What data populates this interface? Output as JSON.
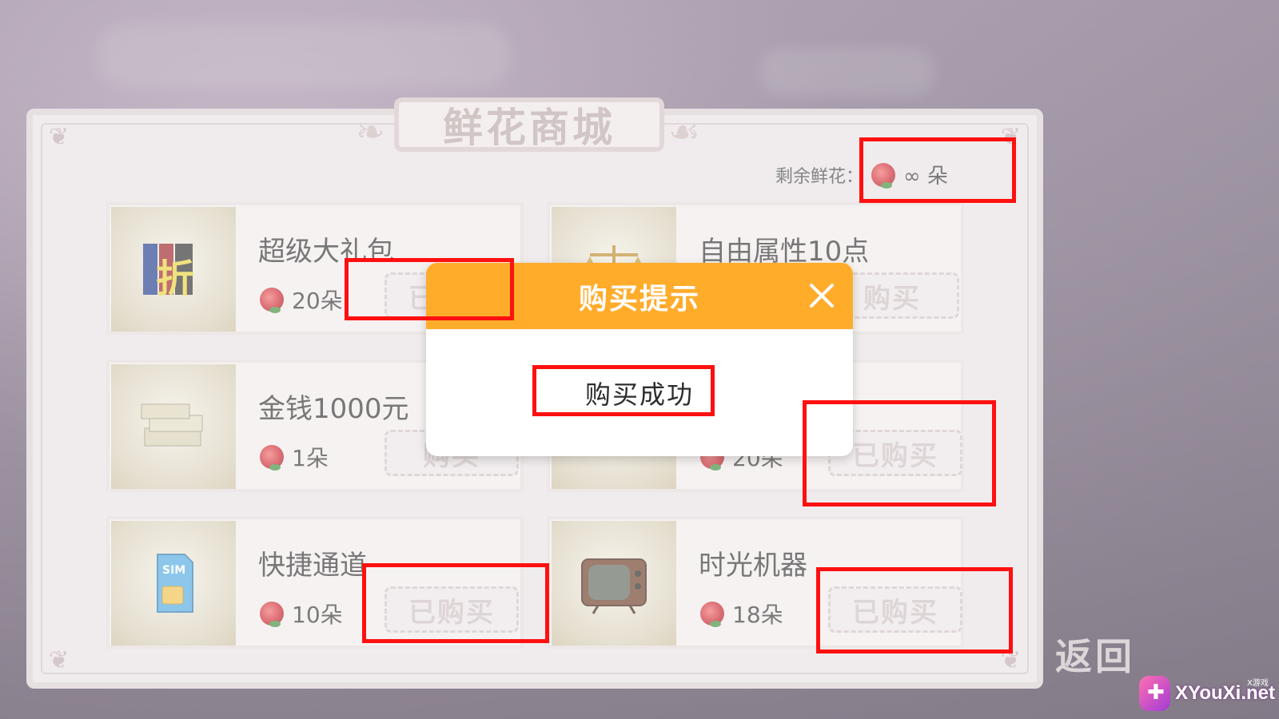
{
  "shop": {
    "title": "鲜花商城",
    "remaining_label": "剩余鲜花：",
    "remaining_amount": "∞ 朵",
    "back_label": "返回",
    "items": [
      {
        "name": "超级大礼包",
        "price": "20朵",
        "button": "已购买",
        "icon": "binders-discount-icon"
      },
      {
        "name": "自由属性10点",
        "price": "",
        "button": "购买",
        "icon": "scale-icon"
      },
      {
        "name": "金钱1000元",
        "price": "1朵",
        "button": "购买",
        "icon": "money-stack-icon"
      },
      {
        "name": "",
        "price": "20朵",
        "button": "已购买",
        "icon": "item-icon"
      },
      {
        "name": "快捷通道",
        "price": "10朵",
        "button": "已购买",
        "icon": "sim-card-icon"
      },
      {
        "name": "时光机器",
        "price": "18朵",
        "button": "已购买",
        "icon": "tv-icon"
      }
    ]
  },
  "dialog": {
    "title": "购买提示",
    "message": "购买成功",
    "close_icon": "close-icon"
  },
  "watermark": {
    "text": "XYouXi.net",
    "sub": "X游戏"
  },
  "colors": {
    "dialog_header": "#ffac2b",
    "highlight": "#ff1010"
  }
}
